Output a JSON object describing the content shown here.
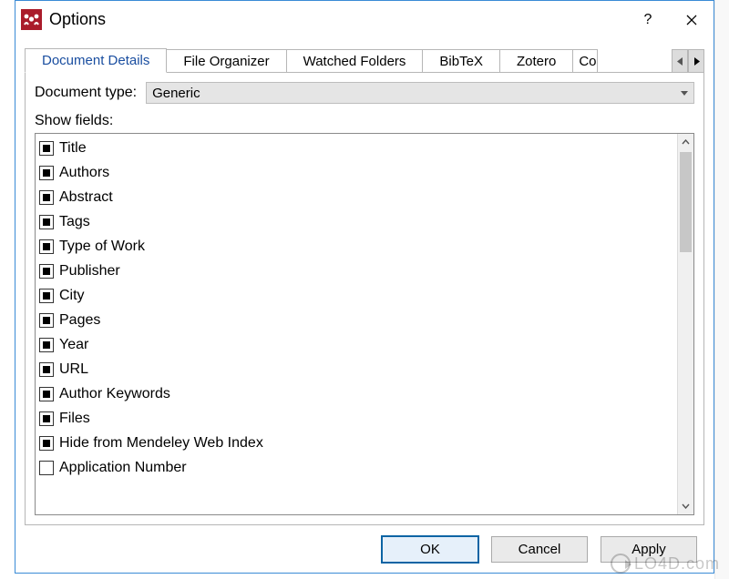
{
  "dialog": {
    "title": "Options"
  },
  "tabs": [
    {
      "label": "Document Details",
      "active": true
    },
    {
      "label": "File Organizer",
      "active": false
    },
    {
      "label": "Watched Folders",
      "active": false
    },
    {
      "label": "BibTeX",
      "active": false
    },
    {
      "label": "Zotero",
      "active": false
    },
    {
      "label": "Connection",
      "active": false,
      "partial": "Co"
    }
  ],
  "docType": {
    "label": "Document type:",
    "value": "Generic"
  },
  "fieldsLabel": "Show fields:",
  "fields": [
    {
      "label": "Title",
      "checked": true
    },
    {
      "label": "Authors",
      "checked": true
    },
    {
      "label": "Abstract",
      "checked": true
    },
    {
      "label": "Tags",
      "checked": true
    },
    {
      "label": "Type of Work",
      "checked": true
    },
    {
      "label": "Publisher",
      "checked": true
    },
    {
      "label": "City",
      "checked": true
    },
    {
      "label": "Pages",
      "checked": true
    },
    {
      "label": "Year",
      "checked": true
    },
    {
      "label": "URL",
      "checked": true
    },
    {
      "label": "Author Keywords",
      "checked": true
    },
    {
      "label": "Files",
      "checked": true
    },
    {
      "label": "Hide from Mendeley Web Index",
      "checked": true
    },
    {
      "label": "Application Number",
      "checked": false
    }
  ],
  "buttons": {
    "ok": "OK",
    "cancel": "Cancel",
    "apply": "Apply"
  },
  "watermark": "LO4D.com"
}
